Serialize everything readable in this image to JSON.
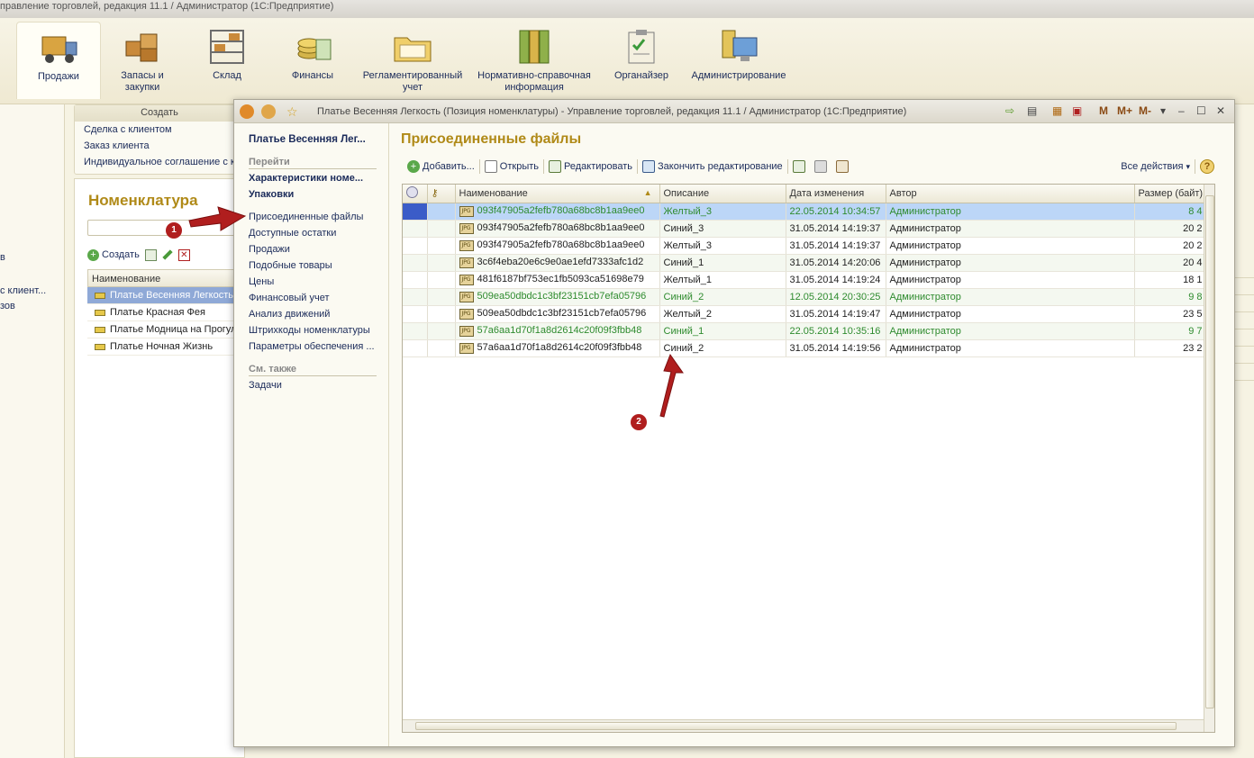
{
  "main_window": {
    "title": "правление торговлей, редакция 11.1 / Администратор  (1С:Предприятие)"
  },
  "sections": [
    {
      "label": "Продажи",
      "icon": "truck-icon"
    },
    {
      "label": "Запасы и закупки",
      "icon": "boxes-icon"
    },
    {
      "label": "Склад",
      "icon": "warehouse-icon"
    },
    {
      "label": "Финансы",
      "icon": "coins-icon"
    },
    {
      "label": "Регламентированный учет",
      "icon": "folder-icon"
    },
    {
      "label": "Нормативно-справочная информация",
      "icon": "binders-icon"
    },
    {
      "label": "Органайзер",
      "icon": "clipboard-icon"
    },
    {
      "label": "Администрирование",
      "icon": "computer-icon"
    }
  ],
  "left_strip": {
    "items": [
      "в",
      "с клиент...",
      "зов"
    ]
  },
  "create_panel": {
    "header": "Создать",
    "items": [
      "Сделка с клиентом",
      "Заказ клиента",
      "Индивидуальное соглашение с к"
    ]
  },
  "nomenclature": {
    "title": "Номенклатура",
    "create_label": "Создать",
    "column": "Наименование",
    "rows": [
      "Платье Весенняя Легкость",
      "Платье Красная Фея",
      "Платье Модница на Прогул",
      "Платье Ночная Жизнь"
    ]
  },
  "child_window": {
    "title": "Платье Весенняя Легкость (Позиция номенклатуры) - Управление торговлей, редакция 11.1 / Администратор  (1С:Предприятие)",
    "right_buttons": [
      "M",
      "M+",
      "M-"
    ]
  },
  "nav": {
    "title": "Платье Весенняя Лег...",
    "group_goto": "Перейти",
    "bold_links": [
      "Характеристики номе...",
      "Упаковки"
    ],
    "links": [
      "Присоединенные файлы",
      "Доступные остатки",
      "Продажи",
      "Подобные товары",
      "Цены",
      "Финансовый учет",
      "Анализ движений",
      "Штрихкоды номенклатуры",
      "Параметры обеспечения ..."
    ],
    "group_see_also": "См. также",
    "see_also": [
      "Задачи"
    ]
  },
  "content": {
    "title": "Присоединенные файлы",
    "toolbar": {
      "add": "Добавить...",
      "open": "Открыть",
      "edit": "Редактировать",
      "finish": "Закончить редактирование",
      "all_actions": "Все действия"
    },
    "columns": [
      "Наименование",
      "Описание",
      "Дата изменения",
      "Автор",
      "Размер (байт)"
    ],
    "rows": [
      {
        "name": "093f47905a2fefb780a68bc8b1aa9ee0",
        "desc": "Желтый_3",
        "date": "22.05.2014 10:34:57",
        "author": "Администратор",
        "size": "8 4",
        "green": true
      },
      {
        "name": "093f47905a2fefb780a68bc8b1aa9ee0",
        "desc": "Синий_3",
        "date": "31.05.2014 14:19:37",
        "author": "Администратор",
        "size": "20 2",
        "green": false
      },
      {
        "name": "093f47905a2fefb780a68bc8b1aa9ee0",
        "desc": "Желтый_3",
        "date": "31.05.2014 14:19:37",
        "author": "Администратор",
        "size": "20 2",
        "green": false
      },
      {
        "name": "3c6f4eba20e6c9e0ae1efd7333afc1d2",
        "desc": "Синий_1",
        "date": "31.05.2014 14:20:06",
        "author": "Администратор",
        "size": "20 4",
        "green": false
      },
      {
        "name": "481f6187bf753ec1fb5093ca51698e79",
        "desc": "Желтый_1",
        "date": "31.05.2014 14:19:24",
        "author": "Администратор",
        "size": "18 1",
        "green": false
      },
      {
        "name": "509ea50dbdc1c3bf23151cb7efa05796",
        "desc": "Синий_2",
        "date": "12.05.2014 20:30:25",
        "author": "Администратор",
        "size": "9 8",
        "green": true
      },
      {
        "name": "509ea50dbdc1c3bf23151cb7efa05796",
        "desc": "Желтый_2",
        "date": "31.05.2014 14:19:47",
        "author": "Администратор",
        "size": "23 5",
        "green": false
      },
      {
        "name": "57a6aa1d70f1a8d2614c20f09f3fbb48",
        "desc": "Синий_1",
        "date": "22.05.2014 10:35:16",
        "author": "Администратор",
        "size": "9 7",
        "green": true
      },
      {
        "name": "57a6aa1d70f1a8d2614c20f09f3fbb48",
        "desc": "Синий_2",
        "date": "31.05.2014 14:19:56",
        "author": "Администратор",
        "size": "23 2",
        "green": false
      }
    ]
  },
  "annotations": {
    "badge1": "1",
    "badge2": "2"
  },
  "colors": {
    "title_gold": "#b08a18",
    "link_blue": "#1b2b5a",
    "arrow_red": "#b01e1e",
    "selection": "#bcd6f7",
    "green_text": "#2e8b2e"
  }
}
